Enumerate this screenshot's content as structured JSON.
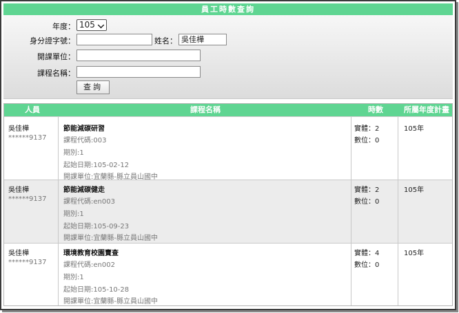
{
  "title": "員工時數查詢",
  "form": {
    "year_label": "年度：",
    "year_value": "105",
    "id_label": "身分證字號：",
    "id_value": "",
    "name_label": "姓名：",
    "name_value": "吳佳樺",
    "unit_label": "開課單位：",
    "unit_value": "",
    "course_label": "課程名稱：",
    "course_value": "",
    "query_button": "查詢"
  },
  "table": {
    "headers": [
      "人員",
      "課程名稱",
      "時數",
      "所屬年度計畫"
    ],
    "rows": [
      {
        "person": "吳佳樺",
        "id_masked": "******9137",
        "course": "節能減碳研習",
        "code": "課程代碼:003",
        "period": "期別:1",
        "start": "起始日期:105-02-12",
        "unit": "開課單位:宜蘭縣-縣立員山國中",
        "hours_physical": "實體：2",
        "hours_digital": "數位：0",
        "plan_year": "105年"
      },
      {
        "person": "吳佳樺",
        "id_masked": "******9137",
        "course": "節能減碳健走",
        "code": "課程代碼:en003",
        "period": "期別:1",
        "start": "起始日期:105-09-23",
        "unit": "開課單位:宜蘭縣-縣立員山國中",
        "hours_physical": "實體：2",
        "hours_digital": "數位：0",
        "plan_year": "105年"
      },
      {
        "person": "吳佳樺",
        "id_masked": "******9137",
        "course": "環境教育校園賣查",
        "code": "課程代碼:en002",
        "period": "期別:1",
        "start": "起始日期:105-10-28",
        "unit": "開課單位:宜蘭縣-縣立員山國中",
        "hours_physical": "實體：4",
        "hours_digital": "數位：0",
        "plan_year": "105年"
      }
    ]
  },
  "colors": {
    "header_green": "#5fd592",
    "alt_row": "#ececec"
  }
}
